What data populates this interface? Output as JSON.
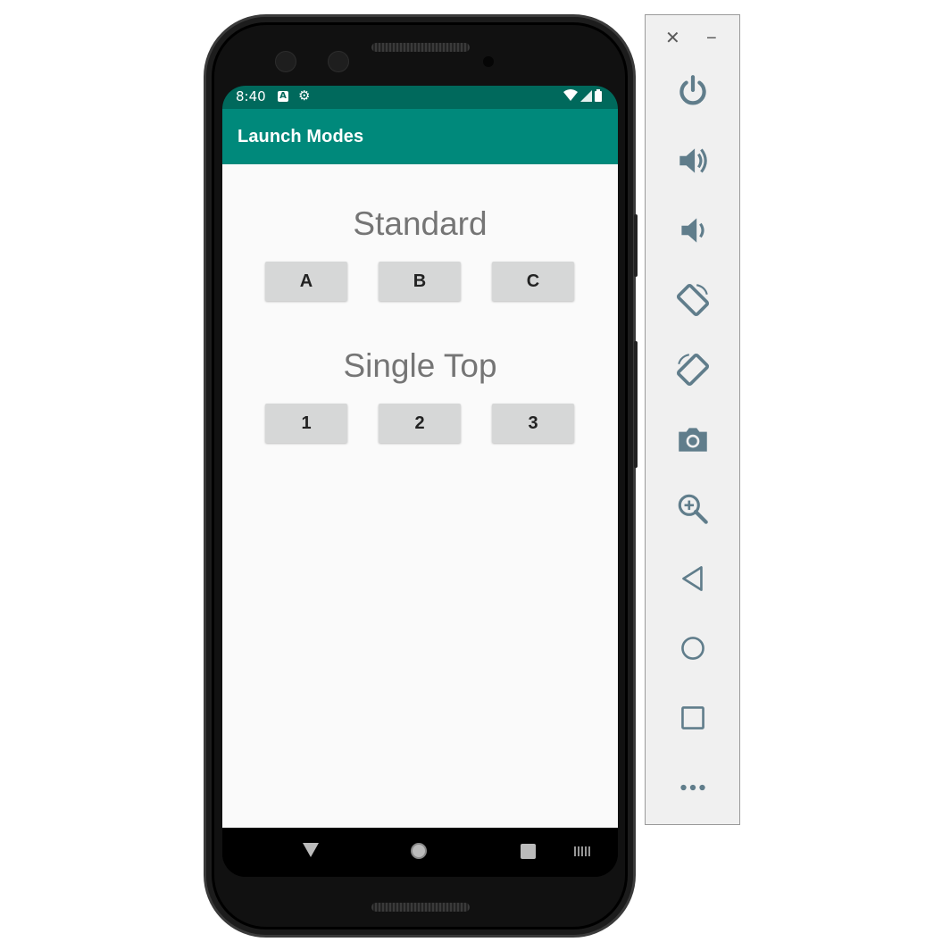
{
  "status_bar": {
    "time": "8:40",
    "a_badge": "A"
  },
  "app_bar": {
    "title": "Launch Modes"
  },
  "sections": {
    "standard": {
      "title": "Standard",
      "buttons": [
        "A",
        "B",
        "C"
      ]
    },
    "single_top": {
      "title": "Single Top",
      "buttons": [
        "1",
        "2",
        "3"
      ]
    }
  },
  "emulator_panel": {
    "close_label": "✕",
    "minimize_label": "−",
    "controls": [
      "power-icon",
      "volume-up-icon",
      "volume-down-icon",
      "rotate-left-icon",
      "rotate-right-icon",
      "camera-icon",
      "zoom-icon",
      "back-icon",
      "home-icon",
      "overview-icon",
      "more-icon"
    ]
  },
  "colors": {
    "status_bar": "#00695c",
    "app_bar": "#00897b",
    "content_bg": "#fafafa",
    "button_bg": "#d6d7d7",
    "section_text": "#757575",
    "emulator_icon": "#607d8b"
  }
}
